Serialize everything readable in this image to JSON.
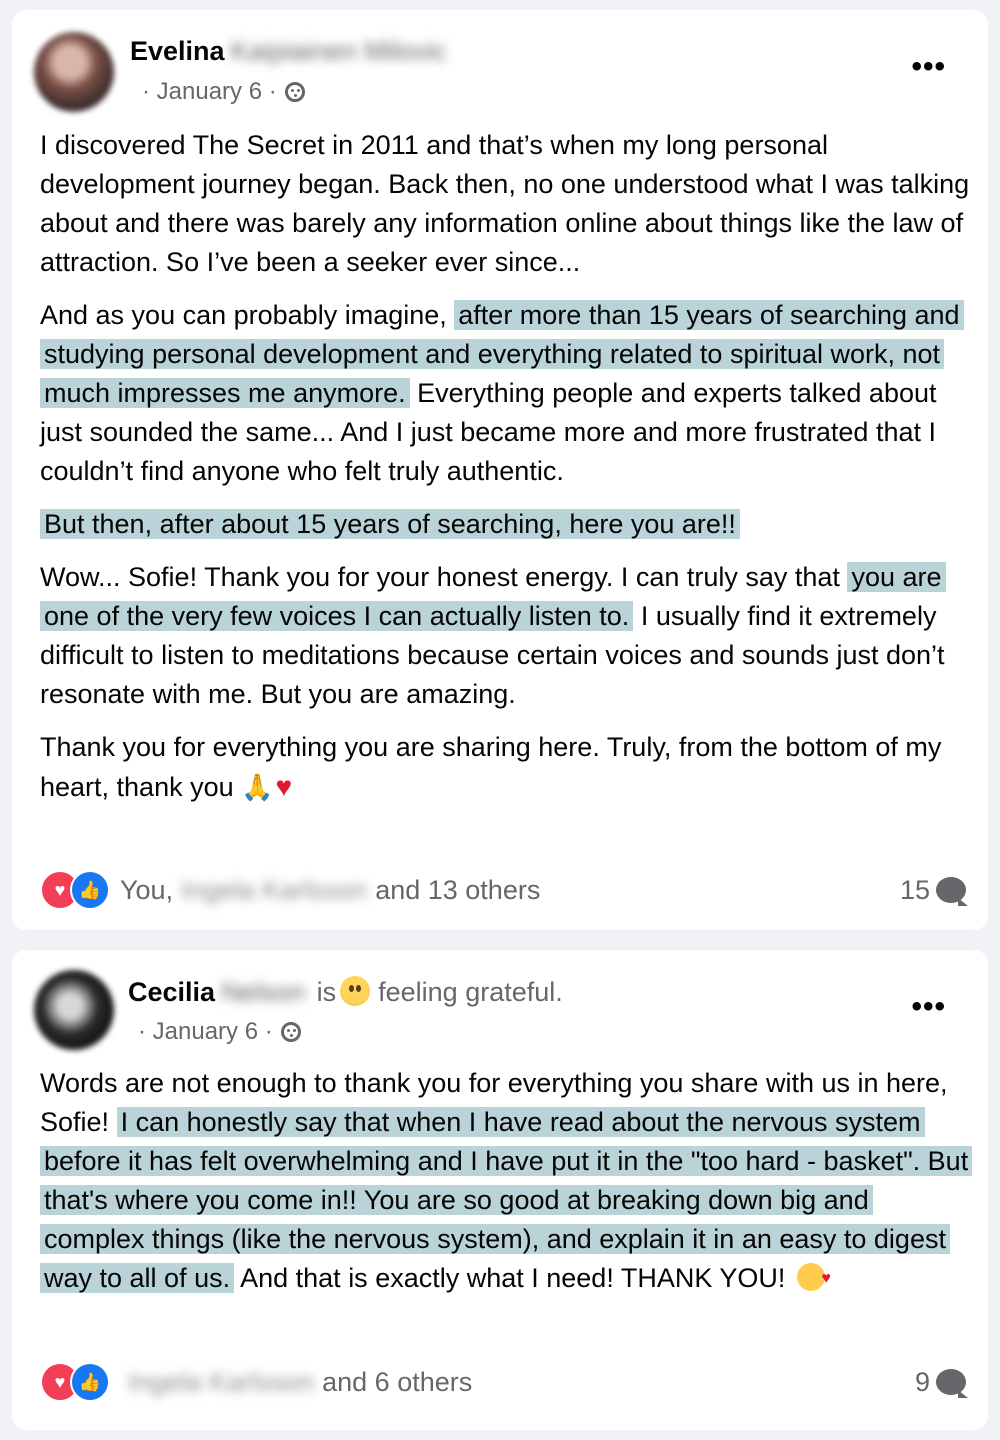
{
  "colors": {
    "highlight": "#b9d3d8",
    "meta_text": "#65676b",
    "love": "#f33e58",
    "like": "#1877f2"
  },
  "post1": {
    "author_first": "Evelina",
    "author_last": "Kaipiainen Milovic",
    "date": "· January 6 ·",
    "privacy_icon": "friends-icon",
    "paragraph1": "I discovered The Secret in 2011 and that’s when my long personal development journey began. Back then, no one understood what I was talking about and there was barely any information online about things like the law of attraction. So I’ve been a seeker ever since...",
    "p2_plain_before": "And as you can probably imagine,",
    "p2_highlight": "after more than 15 years of searching and studying personal development and everything related to spiritual work, not much impresses me anymore.",
    "p2_plain_after": "Everything people and experts talked about just sounded the same... And I just became more and more frustrated that I couldn’t find anyone who felt truly authentic.",
    "p3_highlight": "But then, after about 15 years of searching, here you are!!",
    "p4_plain_before": "Wow... Sofie! Thank you for your honest energy. I can truly say that",
    "p4_highlight": "you are one of the very few voices I can actually listen to.",
    "p4_plain_after": "I usually find it extremely difficult to listen to meditations because certain voices and sounds just don’t resonate with me. But you are amazing.",
    "p5_text": "Thank you for everything you are sharing here. Truly, from the bottom of my heart, thank you",
    "p5_emoji1": "🙏",
    "p5_emoji2": "♥",
    "reactions_prefix": "You,",
    "reactions_blurred_name": "Ingela Karlsson",
    "reactions_suffix": "and 13 others",
    "comment_count": "15"
  },
  "post2": {
    "author_first": "Cecilia",
    "author_last": "Nelson",
    "feeling_is": "is",
    "feeling_text": "feeling grateful.",
    "date": "· January 6 ·",
    "privacy_icon": "friends-icon",
    "p1_plain_before": "Words are not enough to thank you for everything you share with us in here, Sofie!",
    "p1_highlight": "I can honestly say that when I have read about the nervous system before it has felt overwhelming and I have put it in the \"too hard - basket\". But that's where you come in!! You are so good at breaking down big and complex things (like the nervous system), and explain it in an easy to digest way to all of us.",
    "p1_plain_after": "And that is exactly what I need! THANK YOU!",
    "reactions_blurred_name": "Ingela Karlsson",
    "reactions_suffix": "and 6 others",
    "comment_count": "9"
  },
  "icons": {
    "more": "•••",
    "love": "♥",
    "like": "👍"
  }
}
